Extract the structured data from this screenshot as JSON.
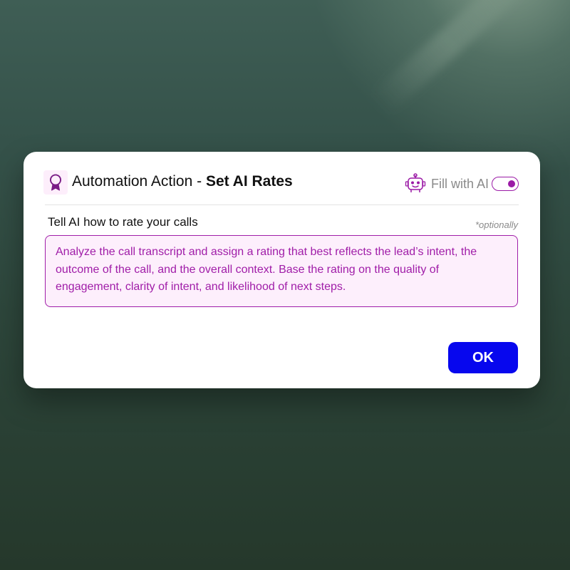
{
  "dialog": {
    "icon": "award-ribbon-icon",
    "title_prefix": "Automation Action - ",
    "title_bold": "Set AI Rates"
  },
  "fill_with_ai": {
    "icon": "robot-icon",
    "label": "Fill with AI",
    "enabled": true
  },
  "prompt": {
    "label": "Tell AI how to rate your calls",
    "optional_note": "*optionally",
    "text": "Analyze the call transcript and assign a rating that best reflects the lead’s intent, the outcome of the call, and the overall context. Base the rating on the quality of engagement, clarity of intent, and likelihood of next steps."
  },
  "actions": {
    "ok_label": "OK"
  },
  "colors": {
    "accent": "#a01da8",
    "primary_button": "#0707ee",
    "prompt_background": "#fdeffc"
  }
}
